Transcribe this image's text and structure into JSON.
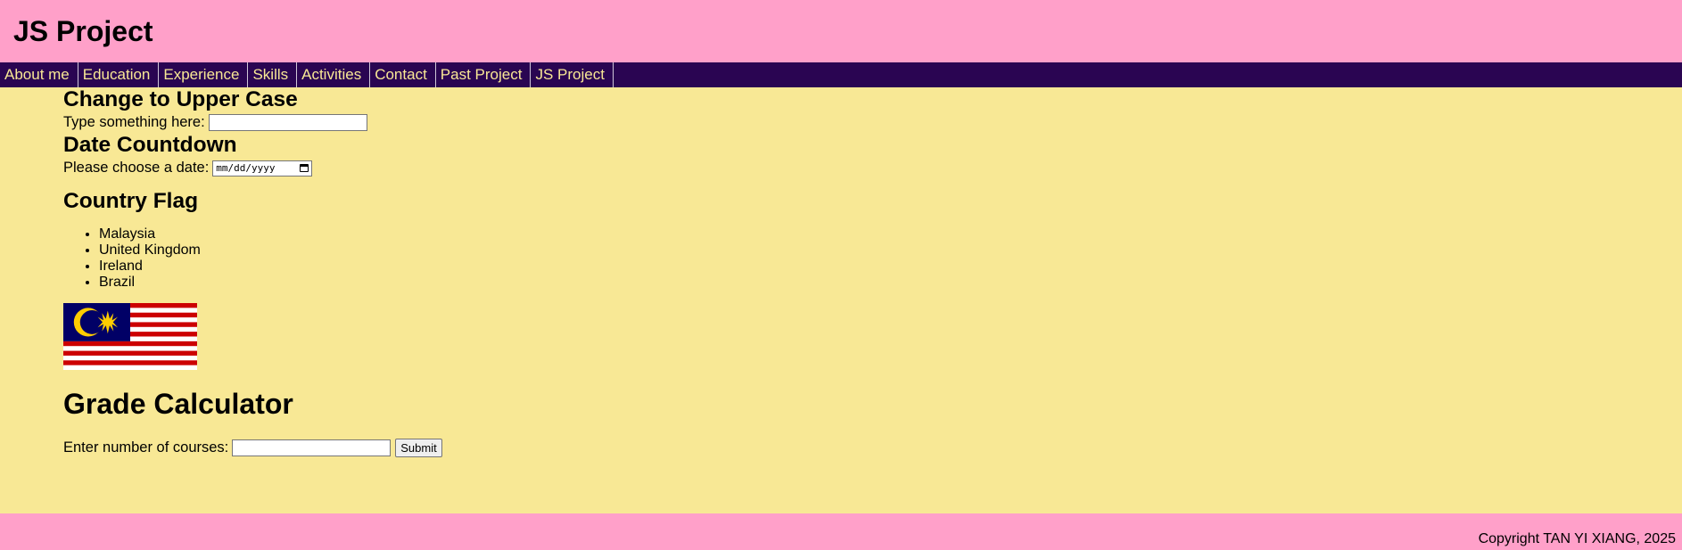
{
  "header": {
    "title": "JS Project"
  },
  "nav": {
    "items": [
      {
        "label": "About me"
      },
      {
        "label": "Education"
      },
      {
        "label": "Experience"
      },
      {
        "label": "Skills"
      },
      {
        "label": "Activities"
      },
      {
        "label": "Contact"
      },
      {
        "label": "Past Project"
      },
      {
        "label": "JS Project"
      }
    ]
  },
  "upper_case": {
    "heading": "Change to Upper Case",
    "label": "Type something here:",
    "value": ""
  },
  "countdown": {
    "heading": "Date Countdown",
    "label": "Please choose a date:",
    "placeholder": "mm/dd/yyyy"
  },
  "flag": {
    "heading": "Country Flag",
    "countries": [
      "Malaysia",
      "United Kingdom",
      "Ireland",
      "Brazil"
    ],
    "selected": "Malaysia",
    "colors": {
      "red": "#cc0001",
      "white": "#ffffff",
      "blue": "#010066",
      "yellow": "#ffcc00"
    }
  },
  "grade": {
    "heading": "Grade Calculator",
    "label": "Enter number of courses:",
    "value": "",
    "submit_label": "Submit"
  },
  "footer": {
    "copyright": "Copyright TAN YI XIANG, 2025"
  },
  "colors": {
    "background": "#f8e895",
    "header": "#ffa0c9",
    "nav": "#2a0552",
    "nav_text": "#f8e895"
  }
}
